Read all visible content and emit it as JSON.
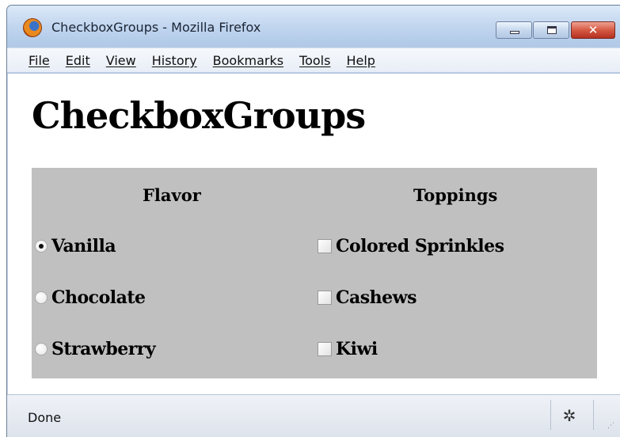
{
  "window": {
    "title": "CheckboxGroups - Mozilla Firefox",
    "icon": "firefox-icon",
    "controls": {
      "minimize": "minimize-icon",
      "maximize": "maximize-icon",
      "close": "✕"
    }
  },
  "menubar": {
    "items": [
      "File",
      "Edit",
      "View",
      "History",
      "Bookmarks",
      "Tools",
      "Help"
    ]
  },
  "page": {
    "heading": "CheckboxGroups",
    "panel_color": "#c0c0c0",
    "flavor": {
      "header": "Flavor",
      "options": [
        {
          "label": "Vanilla",
          "selected": true
        },
        {
          "label": "Chocolate",
          "selected": false
        },
        {
          "label": "Strawberry",
          "selected": false
        }
      ]
    },
    "toppings": {
      "header": "Toppings",
      "options": [
        {
          "label": "Colored Sprinkles",
          "checked": false
        },
        {
          "label": "Cashews",
          "checked": false
        },
        {
          "label": "Kiwi",
          "checked": false
        }
      ]
    }
  },
  "statusbar": {
    "text": "Done",
    "icon": "bug-icon"
  }
}
